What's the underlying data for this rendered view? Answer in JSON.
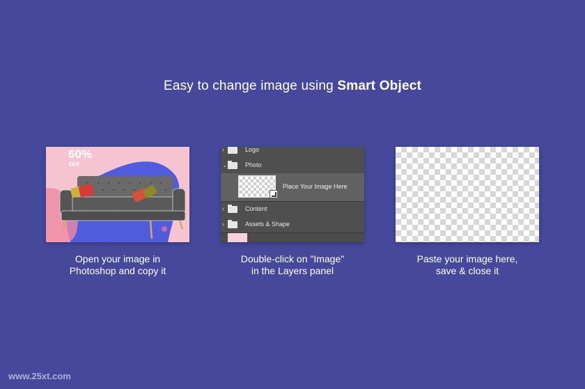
{
  "headline": {
    "prefix": "Easy to change image using ",
    "bold": "Smart Object"
  },
  "step1": {
    "badge_percent": "60%",
    "badge_off": "OFF",
    "caption_line1": "Open your image in",
    "caption_line2": "Photoshop and copy it"
  },
  "step2": {
    "layers": {
      "logo": "Logo",
      "photo": "Photo",
      "placeholder": "Place Your Image Here",
      "content": "Content",
      "assets": "Assets & Shape"
    },
    "caption_line1": "Double-click on \"Image\"",
    "caption_line2": "in the Layers panel"
  },
  "step3": {
    "caption_line1": "Paste your image here,",
    "caption_line2": "save & close it"
  },
  "watermark": "www.25xt.com",
  "colors": {
    "background": "#46489c",
    "pink": "#f6b6c6",
    "blue_blob": "#4f5cdc",
    "sofa": "#5c5c5c",
    "panel": "#4f4f4f"
  }
}
